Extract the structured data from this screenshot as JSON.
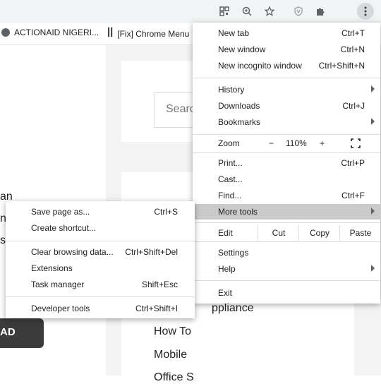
{
  "toolbar": {
    "icons": [
      "qr-code-icon",
      "zoom-icon",
      "star-icon",
      "shield-extension-icon",
      "puzzle-extensions-icon",
      "kebab-menu-icon"
    ]
  },
  "bookmarks": [
    {
      "label": "ACTIONAID NIGERI..."
    },
    {
      "label": "[Fix] Chrome Menu"
    }
  ],
  "page": {
    "search_placeholder": "Searc",
    "links": [
      "ppliance",
      "How To",
      "Mobile",
      "Office S"
    ],
    "left_fragments": [
      "an",
      "n",
      "s"
    ],
    "dark_button": "AD"
  },
  "main_menu": {
    "new_tab": {
      "label": "New tab",
      "shortcut": "Ctrl+T"
    },
    "new_window": {
      "label": "New window",
      "shortcut": "Ctrl+N"
    },
    "new_incognito": {
      "label": "New incognito window",
      "shortcut": "Ctrl+Shift+N"
    },
    "history": {
      "label": "History"
    },
    "downloads": {
      "label": "Downloads",
      "shortcut": "Ctrl+J"
    },
    "bookmarks": {
      "label": "Bookmarks"
    },
    "zoom": {
      "label": "Zoom",
      "minus": "−",
      "value": "110%",
      "plus": "+"
    },
    "print": {
      "label": "Print...",
      "shortcut": "Ctrl+P"
    },
    "cast": {
      "label": "Cast..."
    },
    "find": {
      "label": "Find...",
      "shortcut": "Ctrl+F"
    },
    "more_tools": {
      "label": "More tools"
    },
    "edit": {
      "label": "Edit",
      "cut": "Cut",
      "copy": "Copy",
      "paste": "Paste"
    },
    "settings": {
      "label": "Settings"
    },
    "help": {
      "label": "Help"
    },
    "exit": {
      "label": "Exit"
    }
  },
  "sub_menu": {
    "save_page": {
      "label": "Save page as...",
      "shortcut": "Ctrl+S"
    },
    "create_shortcut": {
      "label": "Create shortcut..."
    },
    "clear_data": {
      "label": "Clear browsing data...",
      "shortcut": "Ctrl+Shift+Del"
    },
    "extensions": {
      "label": "Extensions"
    },
    "task_manager": {
      "label": "Task manager",
      "shortcut": "Shift+Esc"
    },
    "dev_tools": {
      "label": "Developer tools",
      "shortcut": "Ctrl+Shift+I"
    }
  }
}
